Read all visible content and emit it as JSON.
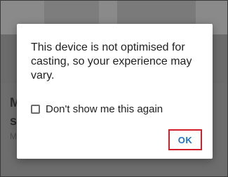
{
  "background": {
    "heading_line1": "M",
    "heading_line2": "s",
    "subtext": "M"
  },
  "dialog": {
    "message": "This device is not optimised for casting, so your experience may vary.",
    "checkbox_label": "Don't show me this again",
    "checkbox_checked": false,
    "ok_label": "OK"
  },
  "colors": {
    "button_text": "#1a73c8",
    "highlight_border": "#d0202a",
    "scrim": "#6b6b6b"
  }
}
